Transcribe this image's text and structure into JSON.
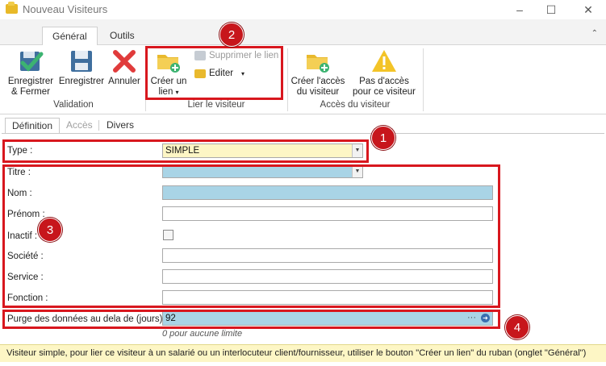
{
  "window": {
    "title": "Nouveau Visiteurs",
    "controls": {
      "minimize": "–",
      "maximize": "☐",
      "close": "✕"
    }
  },
  "ribbon_tabs": [
    {
      "label": "Général",
      "active": true
    },
    {
      "label": "Outils",
      "active": false
    }
  ],
  "ribbon": {
    "validation": {
      "label": "Validation",
      "buttons": [
        {
          "label": "Enregistrer & Fermer",
          "icon": "save-close-icon"
        },
        {
          "label": "Enregistrer",
          "icon": "save-icon"
        },
        {
          "label": "Annuler",
          "icon": "cancel-icon"
        }
      ]
    },
    "lier": {
      "label": "Lier le visiteur",
      "create_link": "Créer un lien",
      "delete_link": "Supprimer le lien",
      "edit": "Editer"
    },
    "acces": {
      "label": "Accès du visiteur",
      "create_access": "Créer l'accès du visiteur",
      "no_access": "Pas d'accès pour ce visiteur"
    }
  },
  "page_tabs": [
    {
      "label": "Définition",
      "state": "active"
    },
    {
      "label": "Accès",
      "state": "disabled"
    },
    {
      "label": "Divers",
      "state": "normal"
    }
  ],
  "form": {
    "type": {
      "label": "Type :",
      "value": "SIMPLE"
    },
    "titre": {
      "label": "Titre :",
      "value": ""
    },
    "nom": {
      "label": "Nom :",
      "value": ""
    },
    "prenom": {
      "label": "Prénom :",
      "value": ""
    },
    "inactif": {
      "label": "Inactif :",
      "checked": false
    },
    "societe": {
      "label": "Société :",
      "value": ""
    },
    "service": {
      "label": "Service :",
      "value": ""
    },
    "fonction": {
      "label": "Fonction :",
      "value": ""
    },
    "purge": {
      "label": "Purge des données au dela de (jours) :",
      "value": "92",
      "hint": "0 pour aucune limite"
    }
  },
  "annotations": [
    "1",
    "2",
    "3",
    "4"
  ],
  "status": "Visiteur simple, pour lier ce visiteur à un salarié ou un interlocuteur client/fournisseur, utiliser le bouton \"Créer un lien\" du ruban (onglet \"Général\")",
  "colors": {
    "accent_red": "#d8171e",
    "required_blue": "#a9d4e6",
    "highlight_yellow": "#fdf6c5"
  }
}
